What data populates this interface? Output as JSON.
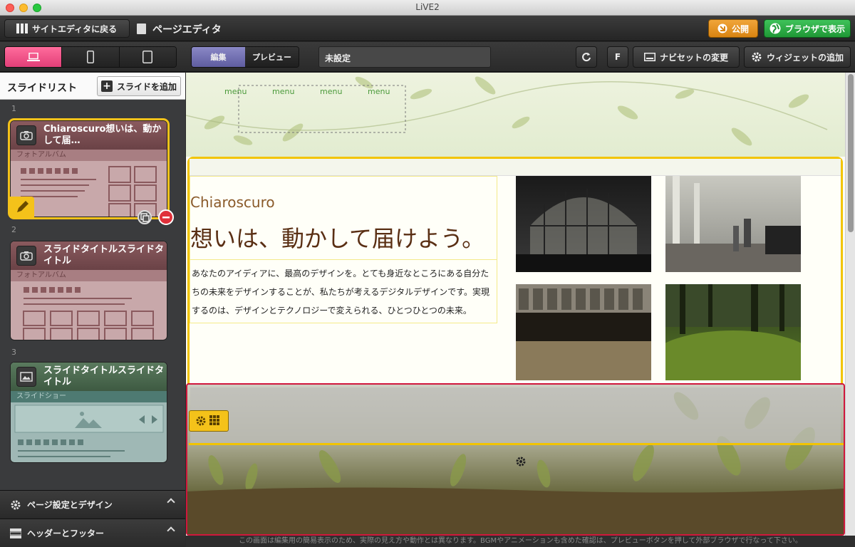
{
  "window": {
    "title": "LiVE2"
  },
  "toolbar": {
    "back_label": "サイトエディタに戻る",
    "page_title": "ページエディタ",
    "publish_label": "公開",
    "browser_label": "ブラウザで表示",
    "edit_label": "編集",
    "preview_label": "プレビュー",
    "page_name": "未設定",
    "font_label": "F",
    "navset_label": "ナビセットの変更",
    "widget_label": "ウィジェットの追加"
  },
  "sidebar": {
    "title": "スライドリスト",
    "add_label": "スライドを追加",
    "slides": [
      {
        "num": "1",
        "title": "Chiaroscuro想いは、動かして届…",
        "type": "フォトアルバム"
      },
      {
        "num": "2",
        "title": "スライドタイトルスライドタイトル",
        "type": "フォトアルバム"
      },
      {
        "num": "3",
        "title": "スライドタイトルスライドタイトル",
        "type": "スライドショー"
      }
    ],
    "page_settings": "ページ設定とデザイン",
    "header_footer": "ヘッダーとフッター"
  },
  "canvas": {
    "menu": [
      "menu",
      "menu",
      "menu",
      "menu"
    ],
    "subtitle": "Chiaroscuro",
    "headline": "想いは、動かして届けよう。",
    "body": "あなたのアイディアに、最高のデザインを。とても身近なところにある自分たちの未来をデザインすることが、私たちが考えるデジタルデザインです。実現するのは、デザインとテクノロジーで変えられる、ひとつひとつの未来。"
  },
  "notice": "この画面は編集用の簡易表示のため、実際の見え方や動作とは異なります。BGMやアニメーションも含めた確認は、プレビューボタンを押して外部ブラウザで行なって下さい。",
  "colors": {
    "accent_pink": "#e23f78",
    "publish": "#e08c1a",
    "browser": "#2aa844",
    "selection": "#f4c21a",
    "footer_border": "#d0173c"
  }
}
